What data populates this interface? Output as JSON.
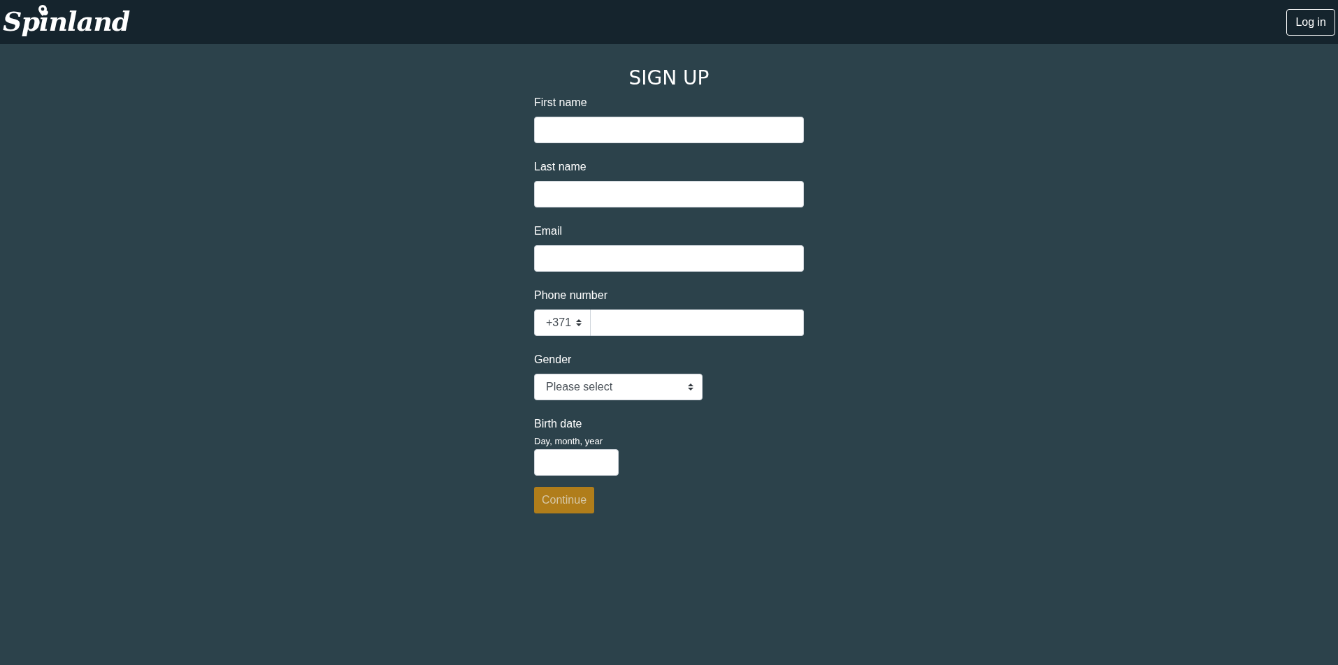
{
  "navbar": {
    "logo": "Spinland",
    "login_button": "Log in"
  },
  "form": {
    "title": "SIGN UP",
    "fields": [
      {
        "kind": "text",
        "label": "First name"
      },
      {
        "kind": "text",
        "label": "Last name"
      },
      {
        "kind": "text",
        "label": "Email"
      },
      {
        "kind": "phone",
        "label": "Phone number",
        "code": "+371"
      },
      {
        "kind": "select",
        "label": "Gender",
        "value": "Please select"
      },
      {
        "kind": "date",
        "label": "Birth date",
        "hint": "Day, month, year"
      }
    ],
    "submit": {
      "label": "Continue",
      "disabled": true
    }
  }
}
